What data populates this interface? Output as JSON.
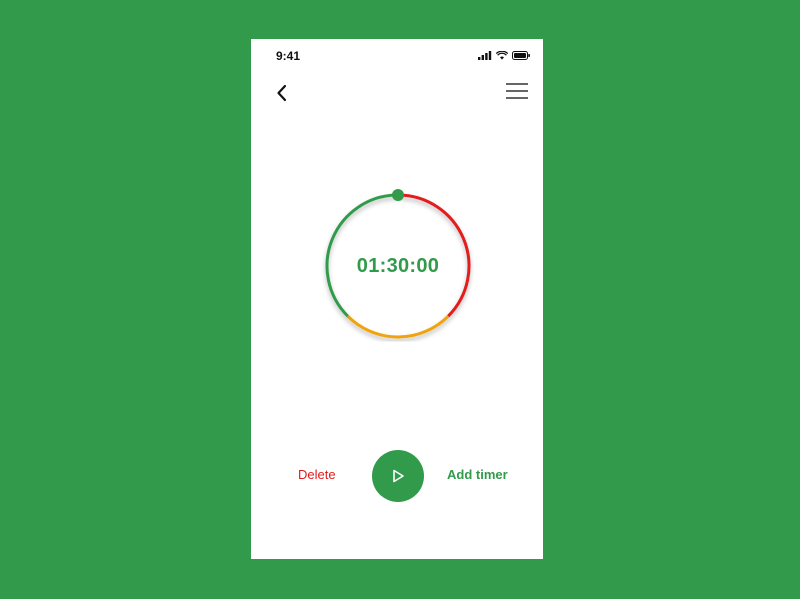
{
  "status_bar": {
    "time": "9:41",
    "icons": [
      "cellular-signal-icon",
      "wifi-icon",
      "battery-icon"
    ]
  },
  "nav": {
    "back_icon": "chevron-left-icon",
    "menu_icon": "hamburger-menu-icon"
  },
  "timer": {
    "display": "01:30:00",
    "ring_colors": {
      "green": "#319b4b",
      "red": "#e31b1b",
      "orange": "#f0a30a"
    }
  },
  "controls": {
    "delete_label": "Delete",
    "add_label": "Add timer",
    "play_icon": "play-icon"
  },
  "colors": {
    "background": "#319b4b",
    "card": "#ffffff",
    "accent": "#319b4b",
    "danger": "#e31b1b"
  }
}
